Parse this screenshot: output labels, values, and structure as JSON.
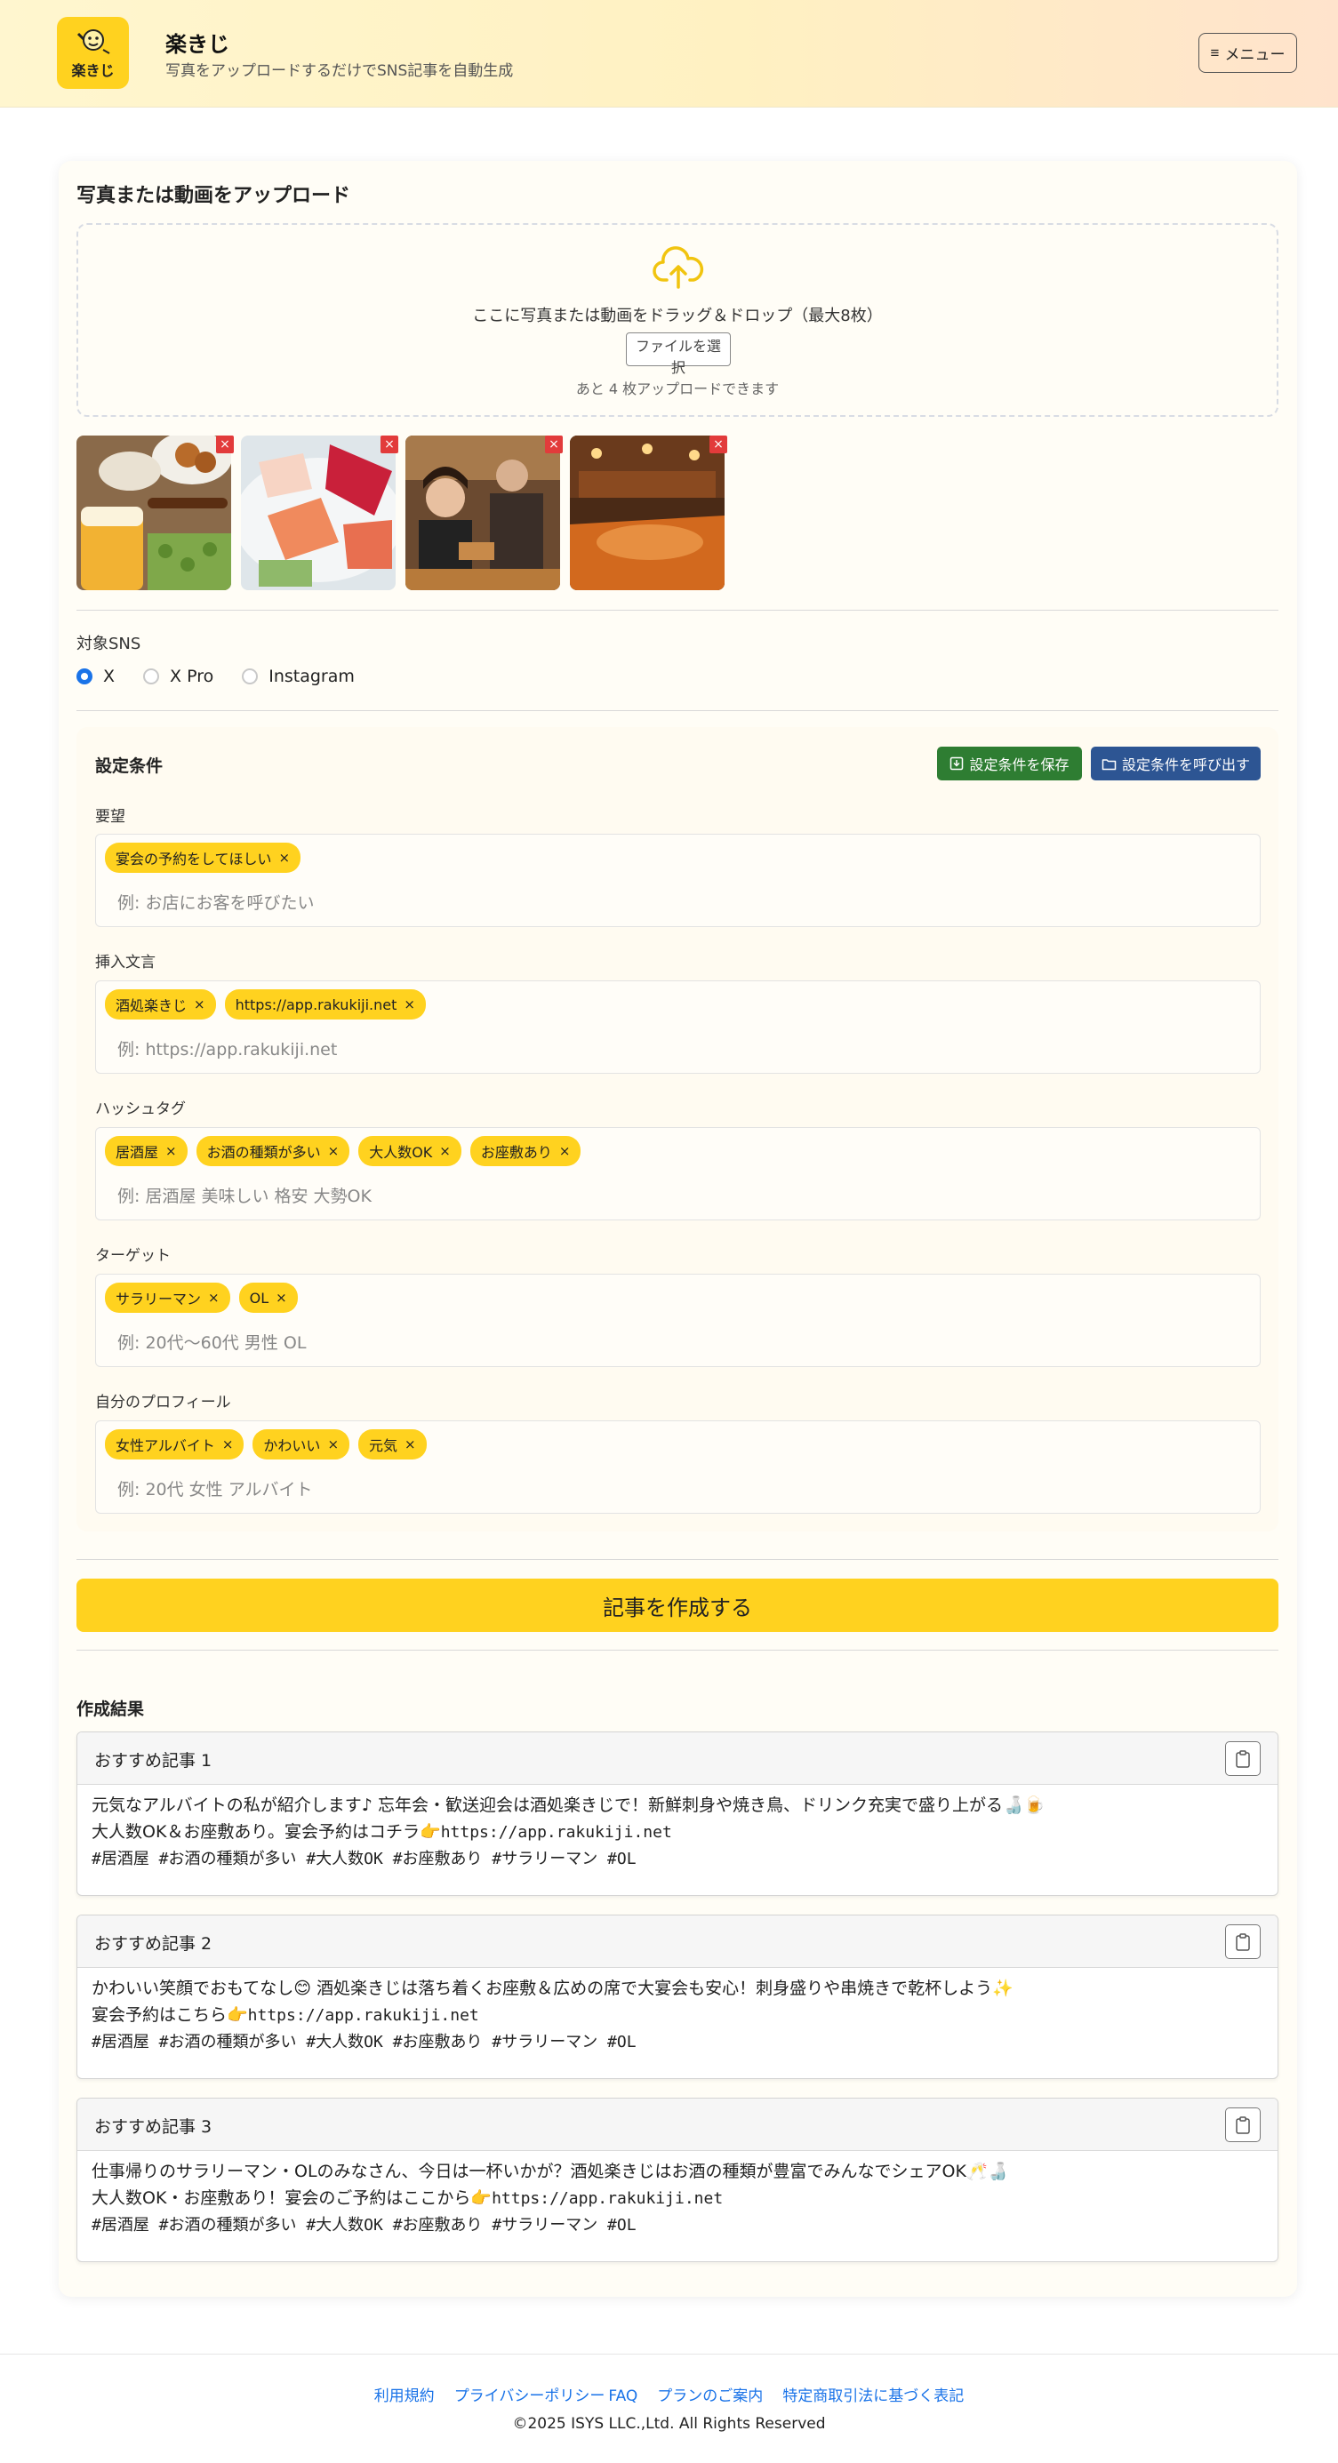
{
  "header": {
    "app_title": "楽きじ",
    "app_subtitle": "写真をアップロードするだけでSNS記事を自動生成",
    "logo_text": "楽きじ",
    "menu_label": "メニュー"
  },
  "upload": {
    "section_title": "写真または動画をアップロード",
    "drop_text": "ここに写真または動画をドラッグ＆ドロップ（最大8枚）",
    "select_button": "ファイルを選択",
    "remaining_text": "あと 4 枚アップロードできます",
    "thumbnails": [
      "居酒屋料理とビール",
      "刺身盛り合わせ",
      "店員と客",
      "店内の様子"
    ]
  },
  "sns": {
    "label": "対象SNS",
    "options": [
      "X",
      "X Pro",
      "Instagram"
    ],
    "selected": "X"
  },
  "settings": {
    "title": "設定条件",
    "save_label": "設定条件を保存",
    "load_label": "設定条件を呼び出す",
    "fields": [
      {
        "label": "要望",
        "chips": [
          "宴会の予約をしてほしい"
        ],
        "placeholder": "例: お店にお客を呼びたい"
      },
      {
        "label": "挿入文言",
        "chips": [
          "酒処楽きじ",
          "https://app.rakukiji.net"
        ],
        "placeholder": "例: https://app.rakukiji.net"
      },
      {
        "label": "ハッシュタグ",
        "chips": [
          "居酒屋",
          "お酒の種類が多い",
          "大人数OK",
          "お座敷あり"
        ],
        "placeholder": "例: 居酒屋 美味しい 格安 大勢OK"
      },
      {
        "label": "ターゲット",
        "chips": [
          "サラリーマン",
          "OL"
        ],
        "placeholder": "例: 20代〜60代 男性 OL"
      },
      {
        "label": "自分のプロフィール",
        "chips": [
          "女性アルバイト",
          "かわいい",
          "元気"
        ],
        "placeholder": "例: 20代 女性 アルバイト"
      }
    ]
  },
  "create_button": "記事を作成する",
  "results": {
    "title": "作成結果",
    "articles": [
      {
        "title": "おすすめ記事 1",
        "line1": "元気なアルバイトの私が紹介します♪ 忘年会・歓送迎会は酒処楽きじで！新鮮刺身や焼き鳥、ドリンク充実で盛り上がる🍶🍺",
        "line2_text": "大人数OK＆お座敷あり。宴会予約はコチラ👉",
        "line2_url": "https://app.rakukiji.net",
        "line3": "#居酒屋 #お酒の種類が多い #大人数OK #お座敷あり #サラリーマン #OL"
      },
      {
        "title": "おすすめ記事 2",
        "line1": "かわいい笑顔でおもてなし😊  酒処楽きじは落ち着くお座敷＆広めの席で大宴会も安心！刺身盛りや串焼きで乾杯しよう✨",
        "line2_text": "宴会予約はこちら👉",
        "line2_url": "https://app.rakukiji.net",
        "line3": "#居酒屋 #お酒の種類が多い #大人数OK #お座敷あり #サラリーマン #OL"
      },
      {
        "title": "おすすめ記事 3",
        "line1": "仕事帰りのサラリーマン・OLのみなさん、今日は一杯いかが？酒処楽きじはお酒の種類が豊富でみんなでシェアOK🥂🍶",
        "line2_text": "大人数OK・お座敷あり！宴会のご予約はここから👉",
        "line2_url": "https://app.rakukiji.net",
        "line3": "#居酒屋 #お酒の種類が多い #大人数OK #お座敷あり #サラリーマン #OL"
      }
    ]
  },
  "footer": {
    "links": [
      "利用規約",
      "プライバシーポリシー",
      "FAQ",
      "プランのご案内",
      "特定商取引法に基づく表記"
    ],
    "copyright": "©2025 ISYS LLC.,Ltd. All Rights Reserved"
  },
  "colors": {
    "accent": "#ffd21f",
    "save_button": "#2e7d32",
    "load_button": "#2d5593",
    "link": "#1a73e8",
    "remove": "#e23b3b"
  }
}
